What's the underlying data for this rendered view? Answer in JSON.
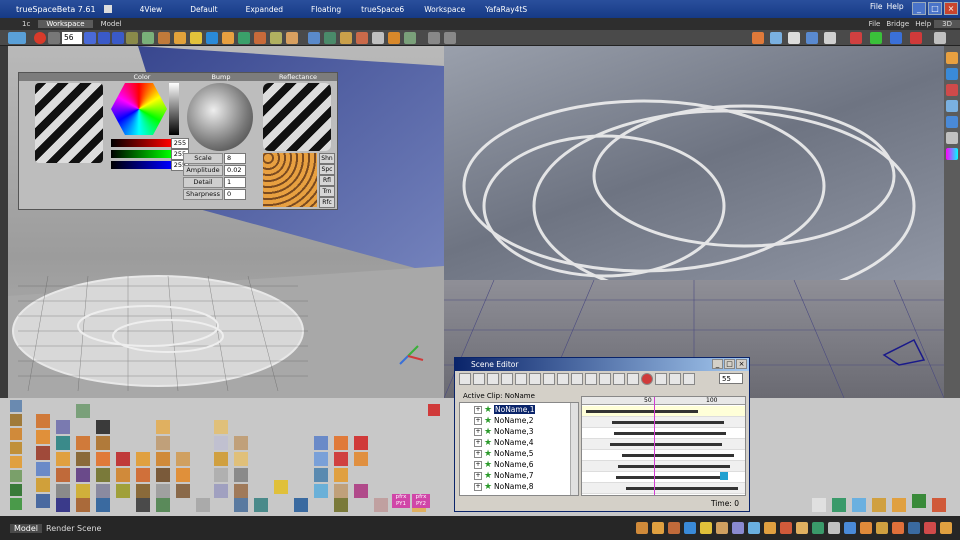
{
  "titlebar": {
    "app_title": "trueSpaceBeta 7.61",
    "layouts": [
      "4View",
      "Default",
      "Expanded",
      "Floating",
      "trueSpace6",
      "Workspace",
      "YafaRay4tS"
    ],
    "right_menu": [
      "File",
      "Help"
    ],
    "window_buttons": [
      "_",
      "□",
      "×"
    ]
  },
  "tabs": {
    "number_tab": "1c",
    "items": [
      "Workspace",
      "Model"
    ],
    "active": "Workspace",
    "right_menu": [
      "File",
      "Bridge",
      "Help"
    ],
    "right_label": "3D"
  },
  "toolbar": {
    "frame_value": "56"
  },
  "material_panels": {
    "color_title": "Color",
    "bump_title": "Bump",
    "reflectance_title": "Reflectance",
    "rgb_values": [
      "255",
      "255",
      "255"
    ],
    "bump_fields": [
      {
        "label": "Scale",
        "value": "8"
      },
      {
        "label": "Amplitude",
        "value": "0.02"
      },
      {
        "label": "Detail",
        "value": "1"
      },
      {
        "label": "Sharpness",
        "value": "0"
      }
    ],
    "reflectance_buttons": [
      "Shn",
      "Spc",
      "Rfl",
      "Trn",
      "Rfc"
    ]
  },
  "scene_editor": {
    "title": "Scene Editor",
    "window_buttons": [
      "_",
      "□",
      "×"
    ],
    "active_clip_label": "Active Clip:",
    "active_clip_value": "NoName",
    "frame_value": "55",
    "ruler_labels": [
      "50",
      "100"
    ],
    "tree": [
      "NoName,1",
      "NoName,2",
      "NoName,3",
      "NoName,4",
      "NoName,5",
      "NoName,6",
      "NoName,7",
      "NoName,8"
    ],
    "selected_row": "NoName,1",
    "time_label": "Time: 0"
  },
  "python_buttons": [
    {
      "top": "pfrx",
      "bottom": "PY1"
    },
    {
      "top": "pfrx",
      "bottom": "PY2"
    }
  ],
  "statusbar": {
    "tabs": [
      "Model",
      "Render Scene"
    ],
    "active": "Model"
  },
  "colors": {
    "titlebar": "#1f4696",
    "scene_editor_title": "#0a246a",
    "selection": "#0a246a",
    "keyframe_cursor": "#d23cd2"
  }
}
